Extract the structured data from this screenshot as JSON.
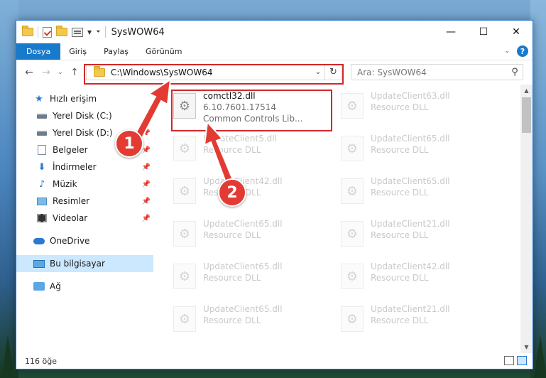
{
  "window": {
    "title": "SysWOW64",
    "controls": {
      "minimize": "—",
      "maximize": "☐",
      "close": "✕"
    }
  },
  "ribbon": {
    "tabs": [
      "Dosya",
      "Giriş",
      "Paylaş",
      "Görünüm"
    ],
    "help": "?"
  },
  "navigation": {
    "address": "C:\\Windows\\SysWOW64",
    "search_placeholder": "Ara: SysWOW64"
  },
  "sidebar": {
    "quick_access": "Hızlı erişim",
    "items": [
      {
        "label": "Yerel Disk (C:)",
        "pinned": false
      },
      {
        "label": "Yerel Disk (D:)",
        "pinned": true
      },
      {
        "label": "Belgeler",
        "pinned": true
      },
      {
        "label": "İndirmeler",
        "pinned": true
      },
      {
        "label": "Müzik",
        "pinned": true
      },
      {
        "label": "Resimler",
        "pinned": true
      },
      {
        "label": "Videolar",
        "pinned": true
      }
    ],
    "onedrive": "OneDrive",
    "this_pc": "Bu bilgisayar",
    "network": "Ağ"
  },
  "files": {
    "selected": {
      "name": "comctl32.dll",
      "version": "6.10.7601.17514",
      "description": "Common Controls Lib..."
    },
    "col1": [
      {
        "name": "UpdateClient5.dll",
        "type": "Resource DLL"
      },
      {
        "name": "UpdateClient42.dll",
        "type": "Resource DLL"
      },
      {
        "name": "UpdateClient65.dll",
        "type": "Resource DLL"
      },
      {
        "name": "UpdateClient65.dll",
        "type": "Resource DLL"
      },
      {
        "name": "UpdateClient65.dll",
        "type": "Resource DLL"
      }
    ],
    "col2": [
      {
        "name": "UpdateClient63.dll",
        "type": "Resource DLL"
      },
      {
        "name": "UpdateClient65.dll",
        "type": "Resource DLL"
      },
      {
        "name": "UpdateClient65.dll",
        "type": "Resource DLL"
      },
      {
        "name": "UpdateClient21.dll",
        "type": "Resource DLL"
      },
      {
        "name": "UpdateClient42.dll",
        "type": "Resource DLL"
      },
      {
        "name": "UpdateClient21.dll",
        "type": "Resource DLL"
      }
    ]
  },
  "status": {
    "count": "116 öğe"
  },
  "callouts": [
    "1",
    "2"
  ],
  "colors": {
    "accent": "#1979ca",
    "highlight": "#d2282a",
    "callout": "#e33b34",
    "selected_nav": "#cce8ff"
  }
}
